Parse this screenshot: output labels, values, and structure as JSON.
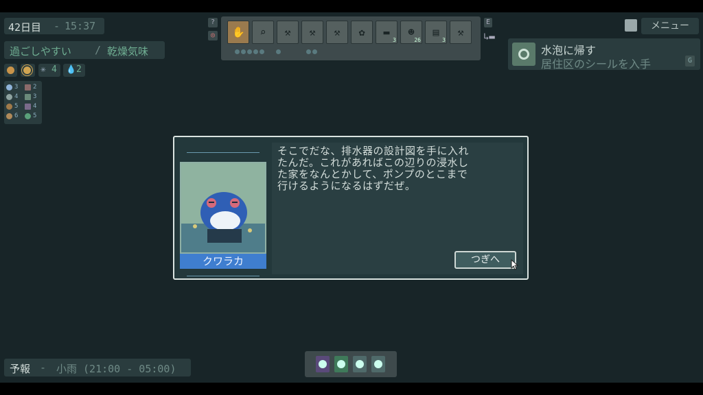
{
  "hud": {
    "day": "42日目",
    "sep": "-",
    "time": "15:37",
    "weather_a": "過ごしやすい",
    "weather_sep": "/",
    "weather_b": "乾燥気味",
    "stats": [
      {
        "icon": "sun-orb-icon",
        "value": ""
      },
      {
        "icon": "sun-icon",
        "value": ""
      },
      {
        "icon": "snowflake-icon",
        "value": "4"
      },
      {
        "icon": "water-drop-icon",
        "value": "2"
      }
    ],
    "inventory": [
      {
        "icon": "moon-icon",
        "count": "3"
      },
      {
        "icon": "brick-icon",
        "count": "2"
      },
      {
        "icon": "orb-icon",
        "count": "4"
      },
      {
        "icon": "grid-icon",
        "count": "3"
      },
      {
        "icon": "seed-icon",
        "count": "5"
      },
      {
        "icon": "leaf-icon",
        "count": "4"
      },
      {
        "icon": "stone-icon",
        "count": "6"
      },
      {
        "icon": "clover-icon",
        "count": "5"
      }
    ],
    "side_keys": [
      "?",
      "◎"
    ],
    "e_key": "E",
    "menu_label": "メニュー"
  },
  "toolbar": {
    "slots": [
      {
        "icon": "hand-icon",
        "glyph": "✋",
        "count": ""
      },
      {
        "icon": "magnifier-icon",
        "glyph": "⌕",
        "count": ""
      },
      {
        "icon": "axe-icon",
        "glyph": "⚒",
        "count": ""
      },
      {
        "icon": "hoe-icon",
        "glyph": "⚒",
        "count": ""
      },
      {
        "icon": "shovel-icon",
        "glyph": "⚒",
        "count": ""
      },
      {
        "icon": "flower-icon",
        "glyph": "✿",
        "count": ""
      },
      {
        "icon": "blade-icon",
        "glyph": "▬",
        "count": "3"
      },
      {
        "icon": "frog-device-icon",
        "glyph": "☻",
        "count": "26"
      },
      {
        "icon": "panel-icon",
        "glyph": "▤",
        "count": "3"
      },
      {
        "icon": "hammer-icon",
        "glyph": "⚒",
        "count": ""
      }
    ]
  },
  "quest": {
    "title": "水泡に帰す",
    "subtitle": "居住区のシールを入手",
    "key": "G"
  },
  "dialog": {
    "speaker": "クワラカ",
    "text": "そこでだな、排水器の設計図を手に入れ\nたんだ。これがあればこの辺りの浸水し\nた家をなんとかして、ポンプのとこまで\n行けるようになるはずだぜ。",
    "next_label": "つぎへ"
  },
  "forecast": {
    "label": "予報",
    "sep": "-",
    "value": "小雨 (21:00 - 05:00)"
  },
  "hotbar": {
    "items": [
      "moon-seal-icon",
      "plant-seal-icon",
      "disc-seal-icon",
      "slash-seal-icon"
    ]
  },
  "colors": {
    "background": "#182528",
    "panel": "#2a3c3e",
    "accent_green": "#6fae92",
    "name_plate": "#3f7ecf"
  }
}
